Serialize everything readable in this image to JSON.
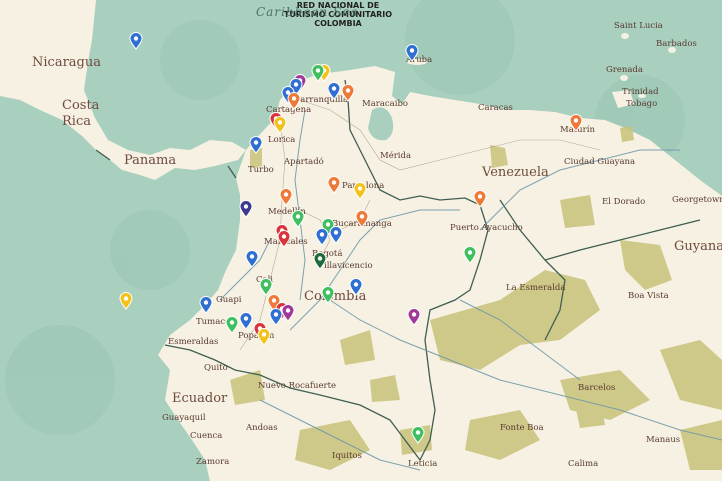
{
  "title": {
    "line1": "RED NACIONAL DE",
    "line2": "TURISMO COMUNITARIO",
    "line3": "COLOMBIA"
  },
  "colors": {
    "sea": "#a9cfbf",
    "land": "#f6f1e2",
    "forest": "#c9c37a",
    "border": "#3f5e52",
    "river": "#6f98a8",
    "pin_blue": "#2f6fd1",
    "pin_green": "#3fbf5f",
    "pin_orange": "#ee7a3a",
    "pin_red": "#d8343a",
    "pin_purple": "#a03a9a",
    "pin_yellow": "#f2c21a",
    "pin_navy": "#3b3a8f",
    "pin_darkgreen": "#1f6b3a"
  },
  "labels": {
    "countries": [
      "Nicaragua",
      "Costa Rica",
      "Panama",
      "Venezuela",
      "Colombia",
      "Ecuador",
      "Guyana"
    ],
    "seas": [
      "Caribbean Sea"
    ],
    "cities": [
      "Cartagena",
      "Barranquilla",
      "Maracaibo",
      "Aruba",
      "Caracas",
      "Saint Lucia",
      "Barbados",
      "Grenada",
      "Trinidad",
      "Tobago",
      "Lorica",
      "Apartadó",
      "Turbo",
      "Mérida",
      "Ciudad Guayana",
      "Maturín",
      "El Dorado",
      "Georgetown",
      "Pamplona",
      "Medellín",
      "Bucaramanga",
      "Puerto Ayacucho",
      "Manizales",
      "Bogotá",
      "Villavicencio",
      "La Esmeralda",
      "Boa Vista",
      "Cali",
      "Guapi",
      "Tumaco",
      "Popayán",
      "Esmeraldas",
      "Quito",
      "Nuevo Rocafuerte",
      "Guayaquil",
      "Cuenca",
      "Zamora",
      "Andoas",
      "Iquitos",
      "Leticia",
      "Barcelos",
      "Fonte Boa",
      "Manaus",
      "Calima"
    ]
  },
  "markers": [
    {
      "name": "marker-blue",
      "color": "pin_blue"
    },
    {
      "name": "marker-green",
      "color": "pin_green"
    },
    {
      "name": "marker-orange",
      "color": "pin_orange"
    },
    {
      "name": "marker-red",
      "color": "pin_red"
    },
    {
      "name": "marker-purple",
      "color": "pin_purple"
    },
    {
      "name": "marker-yellow",
      "color": "pin_yellow"
    },
    {
      "name": "marker-navy",
      "color": "pin_navy"
    },
    {
      "name": "marker-darkgreen",
      "color": "pin_darkgreen"
    }
  ]
}
